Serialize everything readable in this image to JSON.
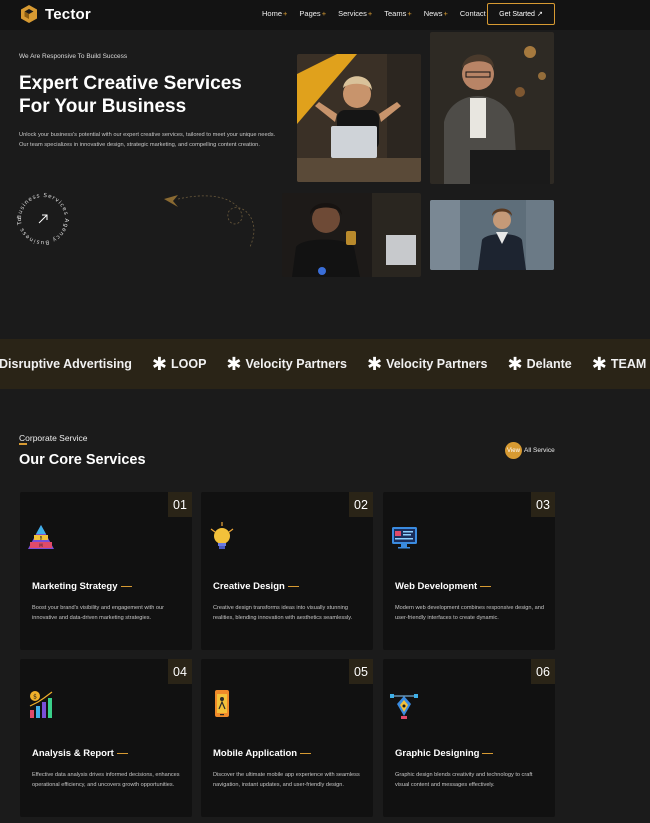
{
  "header": {
    "brand": "Tector",
    "nav": [
      {
        "label": "Home",
        "suffix": "+"
      },
      {
        "label": "Pages",
        "suffix": "+"
      },
      {
        "label": "Services",
        "suffix": "+"
      },
      {
        "label": "Teams",
        "suffix": "+"
      },
      {
        "label": "News",
        "suffix": "+"
      },
      {
        "label": "Contact",
        "suffix": ""
      }
    ],
    "cta": "Get Started",
    "cta_icon": "↗"
  },
  "hero": {
    "eyebrow": "We Are Responsive To Build Success",
    "title_line1": "Expert Creative Services",
    "title_line2": "For Your Business",
    "description": "Unlock your business's potential with our expert creative services, tailored to meet your unique needs. Our team specializes in innovative design, strategic marketing, and compelling content creation.",
    "badge_text": "Business Services Agency Business Tools",
    "badge_icon": "arrow-up-right-icon"
  },
  "brands": [
    "Disruptive Advertising",
    "LOOP",
    "Velocity Partners",
    "Velocity Partners",
    "Delante",
    "TEAM LEWIS"
  ],
  "services": {
    "eyebrow": "Corporate Service",
    "title": "Our Core Services",
    "view_all_prefix": "View",
    "view_all_label": "All Service",
    "cards": [
      {
        "num": "01",
        "title": "Marketing Strategy",
        "text": "Boost your brand's visibility and engagement with our innovative and data-driven marketing strategies.",
        "icon": "pyramid-icon"
      },
      {
        "num": "02",
        "title": "Creative Design",
        "text": "Creative design transforms ideas into visually stunning realities, blending innovation with aesthetics seamlessly.",
        "icon": "lightbulb-icon"
      },
      {
        "num": "03",
        "title": "Web Development",
        "text": "Modern web development combines responsive design, and user-friendly interfaces to create dynamic.",
        "icon": "monitor-icon"
      },
      {
        "num": "04",
        "title": "Analysis & Report",
        "text": "Effective data analysis drives informed decisions, enhances operational efficiency, and uncovers growth opportunities.",
        "icon": "bar-chart-icon"
      },
      {
        "num": "05",
        "title": "Mobile Application",
        "text": "Discover the ultimate mobile app experience with seamless navigation, instant updates, and user-friendly design.",
        "icon": "smartphone-icon"
      },
      {
        "num": "06",
        "title": "Graphic Designing",
        "text": "Graphic design blends creativity and technology to craft visual content and messages effectively.",
        "icon": "pen-tool-icon"
      }
    ]
  },
  "colors": {
    "accent": "#d79a32",
    "background": "#1b1b1b",
    "card": "#111111",
    "band": "#2a2417"
  }
}
